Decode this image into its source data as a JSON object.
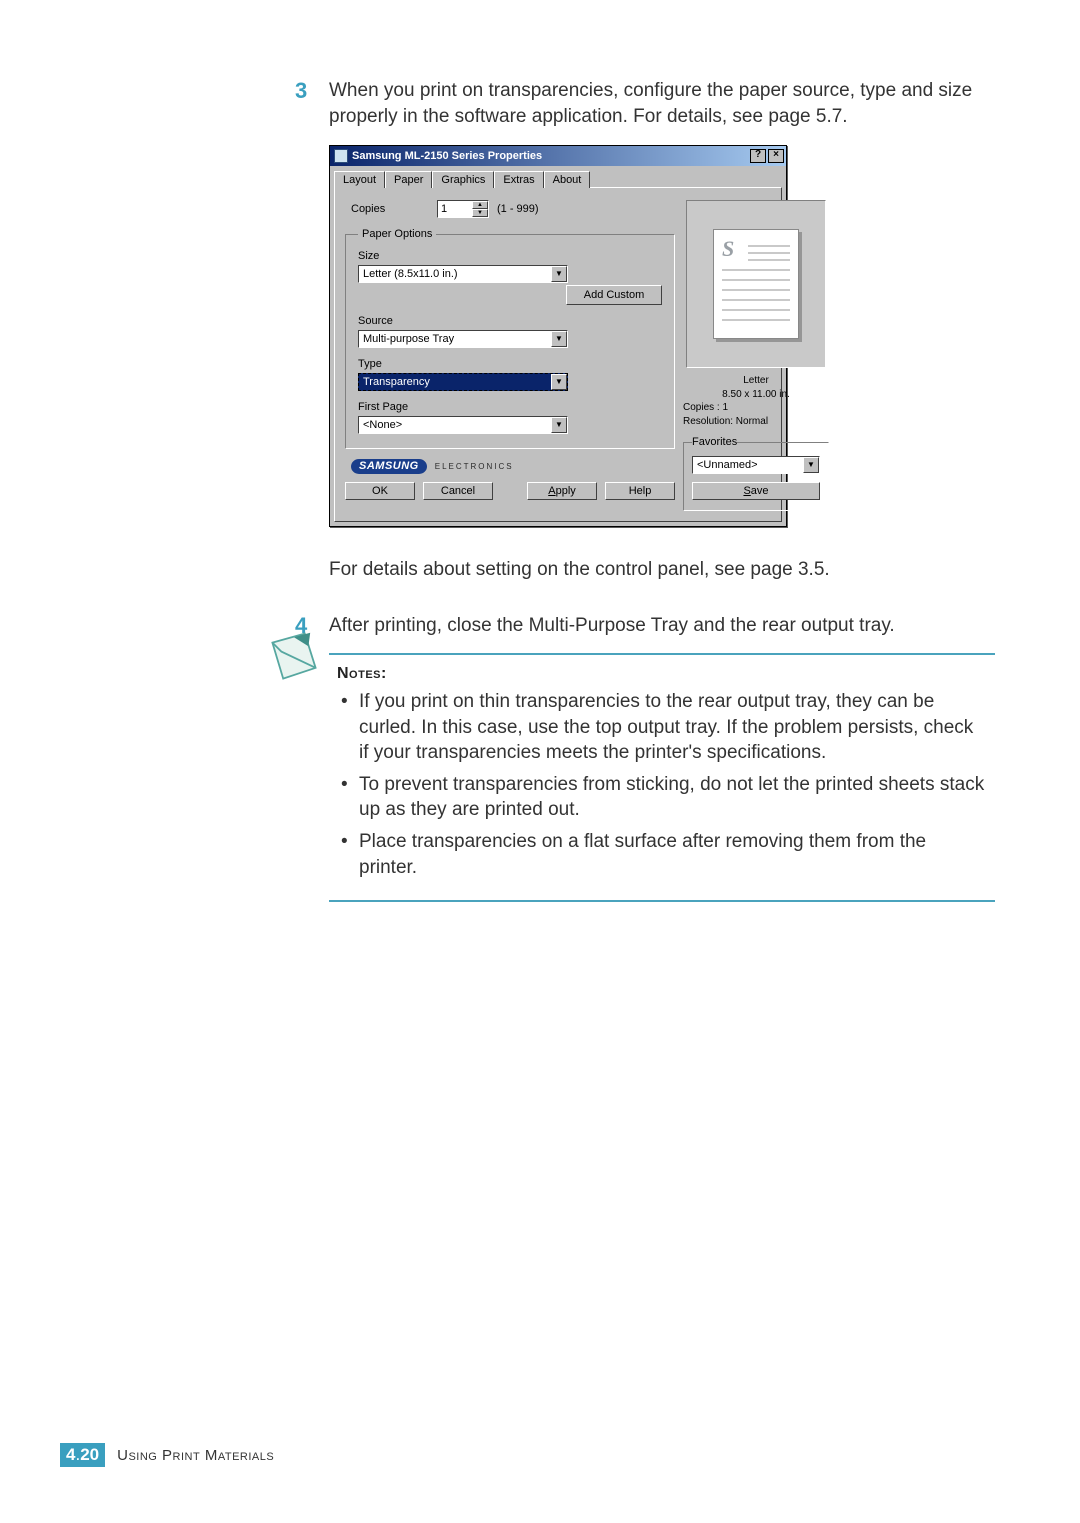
{
  "steps": {
    "s3_num": "3",
    "s3_text": "When you print on transparencies, configure the paper source, type and size properly in the software application. For details, see page 5.7.",
    "s3_after": "For details about setting on the control panel, see page 3.5.",
    "s4_num": "4",
    "s4_text": "After printing, close the Multi-Purpose Tray and the rear output tray."
  },
  "dialog": {
    "title": "Samsung ML-2150 Series Properties",
    "help_glyph": "?",
    "close_glyph": "×",
    "tabs": {
      "layout": "Layout",
      "paper": "Paper",
      "graphics": "Graphics",
      "extras": "Extras",
      "about": "About"
    },
    "copies_label": "Copies",
    "copies_value": "1",
    "copies_range": "(1 - 999)",
    "paper_options_legend": "Paper Options",
    "size_label": "Size",
    "size_value": "Letter (8.5x11.0 in.)",
    "add_custom": "Add Custom",
    "source_label": "Source",
    "source_value": "Multi-purpose Tray",
    "type_label": "Type",
    "type_value": "Transparency",
    "first_page_label": "First Page",
    "first_page_value": "<None>",
    "preview": {
      "line1": "Letter",
      "line2": "8.50 x 11.00 in.",
      "line3": "Copies : 1",
      "line4": "Resolution: Normal"
    },
    "favorites_legend": "Favorites",
    "favorites_value": "<Unnamed>",
    "save_btn": "Save",
    "brand": "SAMSUNG",
    "brand_sub": "ELECTRONICS",
    "ok": "OK",
    "cancel": "Cancel",
    "apply": "Apply",
    "help": "Help"
  },
  "notes": {
    "heading": "Notes:",
    "items": [
      "If you print on thin transparencies to the rear output tray, they can be curled. In this case, use the top output tray. If the problem persists, check if your transparencies meets the printer's specifications.",
      "To prevent transparencies from sticking, do not let the printed sheets stack up as they are printed out.",
      "Place transparencies on a flat surface after removing them from the printer."
    ]
  },
  "footer": {
    "chapter": "4",
    "page": "20",
    "text": "Using Print Materials"
  }
}
